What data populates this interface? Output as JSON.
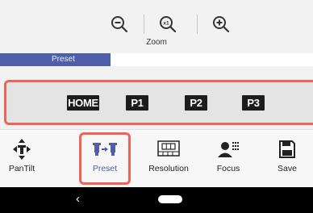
{
  "zoom": {
    "label": "Zoom",
    "buttons": [
      {
        "name": "zoom-out",
        "icon": "zoom-out-icon"
      },
      {
        "name": "zoom-reset",
        "icon": "zoom-x1-icon",
        "text": "x1"
      },
      {
        "name": "zoom-in",
        "icon": "zoom-in-icon"
      }
    ]
  },
  "tabs": {
    "active": "Preset"
  },
  "presets": [
    "HOME",
    "P1",
    "P2",
    "P3"
  ],
  "toolbar": {
    "items": [
      {
        "label": "PanTilt",
        "icon": "pan-tilt-arrows-icon"
      },
      {
        "label": "Preset",
        "icon": "preset-cameras-icon",
        "active": true
      },
      {
        "label": "Resolution",
        "icon": "resolution-grid-icon"
      },
      {
        "label": "Focus",
        "icon": "focus-person-icon"
      },
      {
        "label": "Save",
        "icon": "save-floppy-icon"
      }
    ]
  },
  "navbar": {
    "back_glyph": "‹"
  },
  "colors": {
    "accent": "#4e5fa7",
    "highlight": "#ef6459",
    "preset_button": "#1c1c1c"
  }
}
